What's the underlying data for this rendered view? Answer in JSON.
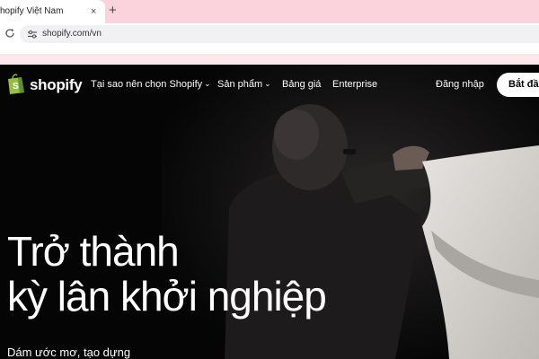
{
  "browser": {
    "tab_title": "hopify Việt Nam",
    "tab_close": "×",
    "new_tab": "+",
    "url": "shopify.com/vn"
  },
  "nav": {
    "logo_text": "shopify",
    "links": [
      {
        "label": "Tại sao nên chọn Shopify",
        "has_dropdown": true
      },
      {
        "label": "Sản phẩm",
        "has_dropdown": true
      },
      {
        "label": "Bảng giá",
        "has_dropdown": false
      },
      {
        "label": "Enterprise",
        "has_dropdown": false
      }
    ],
    "login": "Đăng nhập",
    "cta": "Bắt đầu",
    "chevron": "⌄"
  },
  "hero": {
    "headline_line1": "Trở thành",
    "headline_line2": "kỳ lân khởi nghiệp",
    "subtext": "Dám ước mơ, tạo dựng"
  },
  "colors": {
    "tabstrip": "#fbd3dc",
    "logo_green": "#95bf47",
    "page_bg": "#050505",
    "text": "#ffffff"
  }
}
